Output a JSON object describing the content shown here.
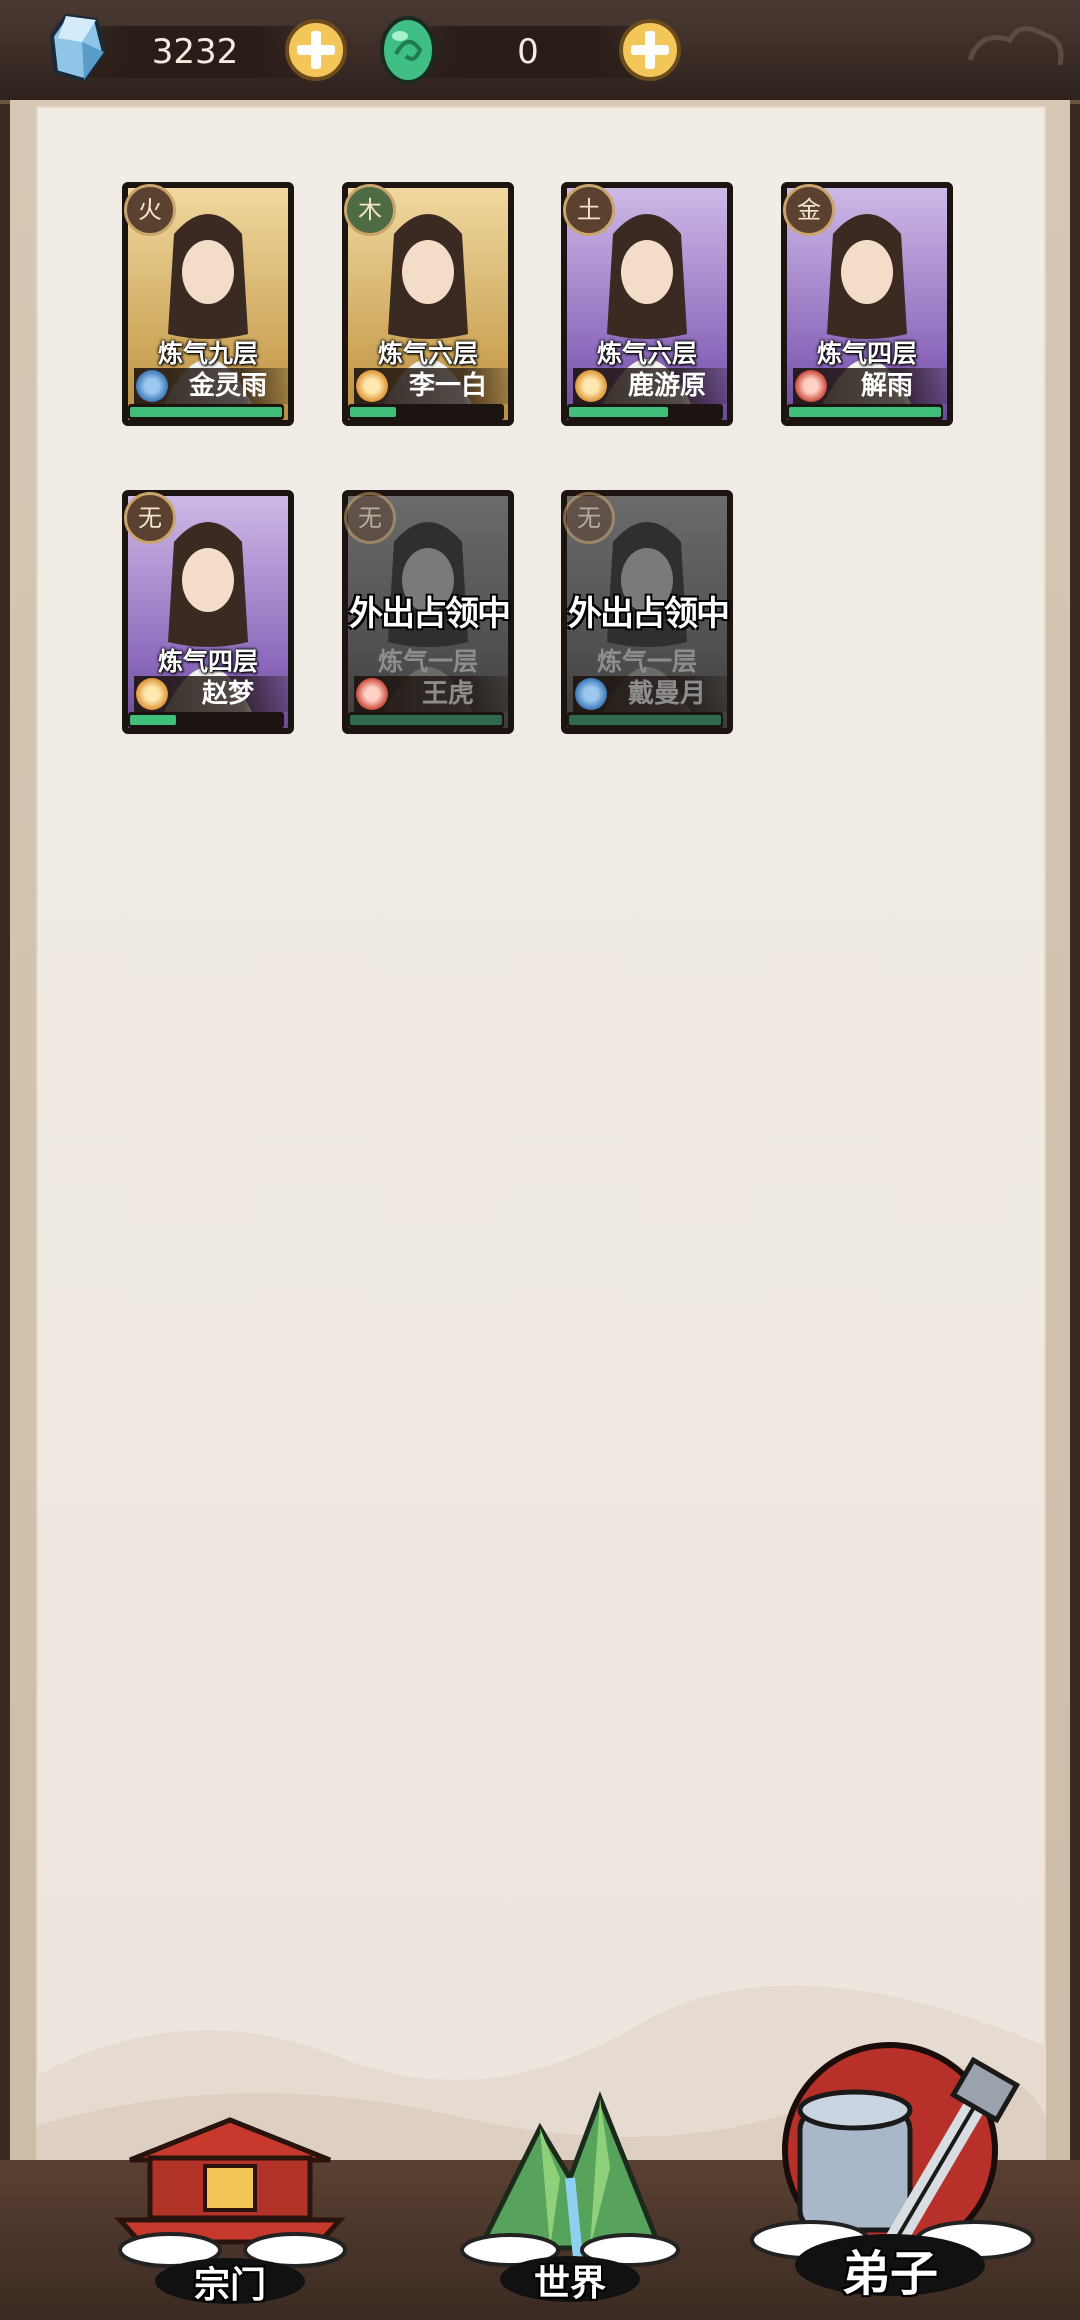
{
  "currency": {
    "spirit_stone": {
      "value": "3232",
      "icon": "spirit-stone-icon"
    },
    "jade": {
      "value": "0",
      "icon": "green-jade-icon"
    }
  },
  "disciples": [
    {
      "realm": "炼气九层",
      "name": "金灵雨",
      "element": "火",
      "sect_icon": "blue-sect-icon",
      "frame": "gold",
      "hp": 1.0,
      "occupied": ""
    },
    {
      "realm": "炼气六层",
      "name": "李一白",
      "element": "木",
      "sect_icon": "orange-sect-icon",
      "frame": "gold",
      "hp": 0.3,
      "occupied": ""
    },
    {
      "realm": "炼气六层",
      "name": "鹿游原",
      "element": "土",
      "sect_icon": "orange-sect-icon",
      "frame": "purple",
      "hp": 0.65,
      "occupied": ""
    },
    {
      "realm": "炼气四层",
      "name": "解雨",
      "element": "金",
      "sect_icon": "red-sect-icon",
      "frame": "purple",
      "hp": 1.0,
      "occupied": ""
    },
    {
      "realm": "炼气四层",
      "name": "赵梦",
      "element": "无",
      "sect_icon": "orange-sect-icon",
      "frame": "purple",
      "hp": 0.3,
      "occupied": ""
    },
    {
      "realm": "炼气一层",
      "name": "王虎",
      "element": "无",
      "sect_icon": "red-sect-icon",
      "frame": "grey",
      "hp": 1.0,
      "occupied": "外出占领中"
    },
    {
      "realm": "炼气一层",
      "name": "戴曼月",
      "element": "无",
      "sect_icon": "blue-sect-icon",
      "frame": "grey",
      "hp": 1.0,
      "occupied": "外出占领中"
    }
  ],
  "nav": {
    "sect": "宗门",
    "world": "世界",
    "disciples": "弟子"
  }
}
